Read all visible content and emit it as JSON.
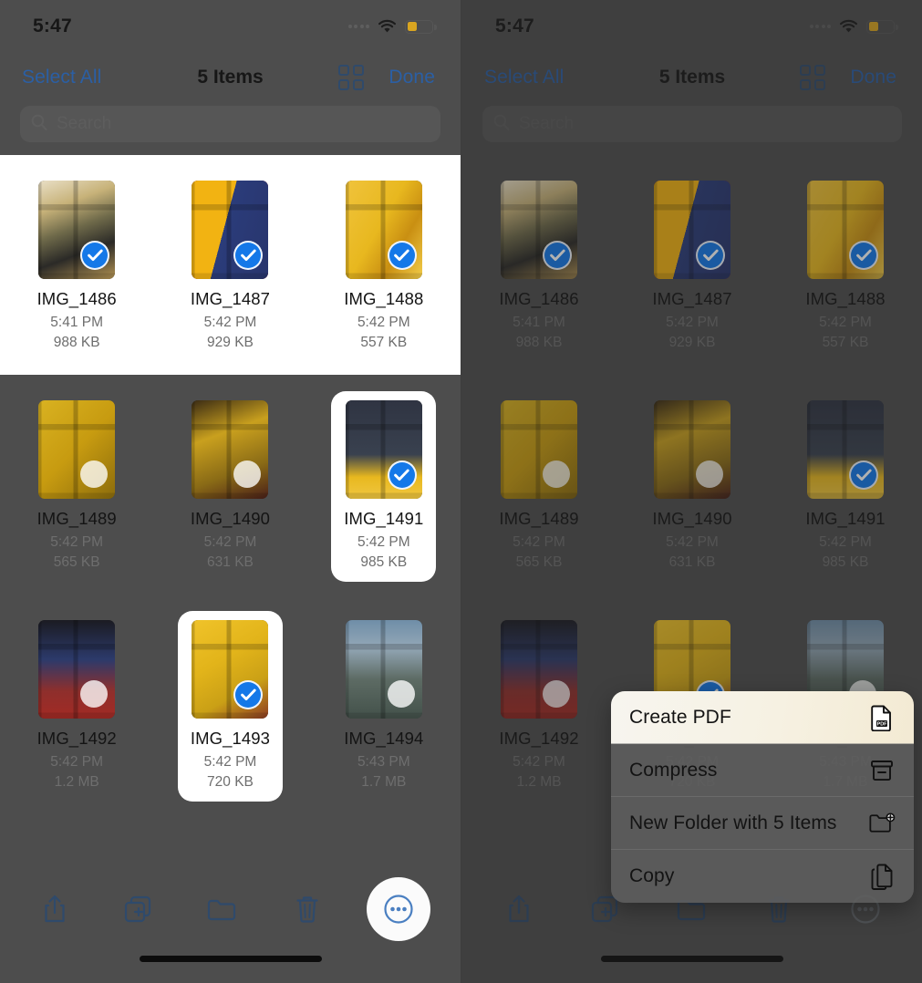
{
  "status": {
    "time": "5:47",
    "wifi_icon": "wifi-icon",
    "battery_icon": "battery-icon",
    "signal_icon": "signal-dots-icon",
    "battery_color": "#d9a520"
  },
  "nav": {
    "select_all": "Select All",
    "title": "5 Items",
    "grid_view_icon": "grid-view-icon",
    "done": "Done",
    "link_color": "#2b5fa4"
  },
  "search": {
    "placeholder": "Search",
    "icon": "search-icon"
  },
  "files": [
    {
      "name": "IMG_1486",
      "time": "5:41 PM",
      "size": "988 KB",
      "selected": true,
      "art": "cafe-plants"
    },
    {
      "name": "IMG_1487",
      "time": "5:42 PM",
      "size": "929 KB",
      "selected": true,
      "art": "jar-blue-red"
    },
    {
      "name": "IMG_1488",
      "time": "5:42 PM",
      "size": "557 KB",
      "selected": true,
      "art": "yellow-plant"
    },
    {
      "name": "IMG_1489",
      "time": "5:42 PM",
      "size": "565 KB",
      "selected": false,
      "art": "yellow-figure"
    },
    {
      "name": "IMG_1490",
      "time": "5:42 PM",
      "size": "631 KB",
      "selected": false,
      "art": "minion-dark"
    },
    {
      "name": "IMG_1491",
      "time": "5:42 PM",
      "size": "985 KB",
      "selected": true,
      "art": "cactus-window"
    },
    {
      "name": "IMG_1492",
      "time": "5:42 PM",
      "size": "1.2 MB",
      "selected": false,
      "art": "figure-redblue"
    },
    {
      "name": "IMG_1493",
      "time": "5:42 PM",
      "size": "720 KB",
      "selected": true,
      "art": "yellow-wall"
    },
    {
      "name": "IMG_1494",
      "time": "5:43 PM",
      "size": "1.7 MB",
      "selected": false,
      "art": "cityscape"
    }
  ],
  "toolbar": {
    "share": "share-icon",
    "duplicate": "duplicate-icon",
    "folder": "folder-icon",
    "trash": "trash-icon",
    "more": "more-ellipsis-icon"
  },
  "context_menu": {
    "items": [
      {
        "label": "Create PDF",
        "icon": "pdf-document-icon",
        "highlighted": true
      },
      {
        "label": "Compress",
        "icon": "archive-box-icon",
        "highlighted": false
      },
      {
        "label": "New Folder with 5 Items",
        "icon": "new-folder-icon",
        "highlighted": false
      },
      {
        "label": "Copy",
        "icon": "copy-pages-icon",
        "highlighted": false
      }
    ]
  },
  "panels": {
    "left_caption": "left-panel-selection-view",
    "right_caption": "right-panel-context-menu-view"
  }
}
